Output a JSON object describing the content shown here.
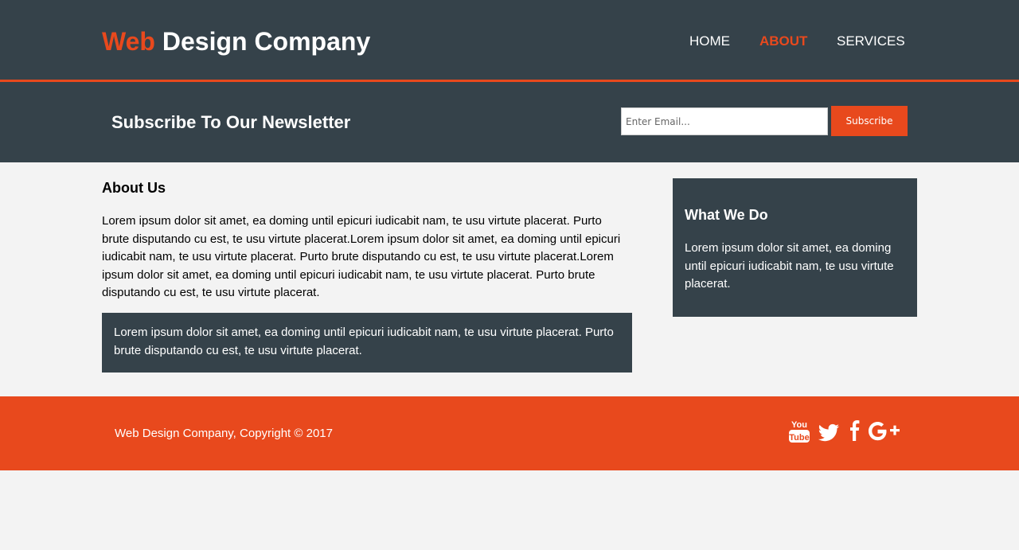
{
  "header": {
    "brand_accent": "Web",
    "brand_rest": " Design Company",
    "nav": [
      {
        "label": "HOME"
      },
      {
        "label": "ABOUT"
      },
      {
        "label": "SERVICES"
      }
    ],
    "active_nav": "ABOUT"
  },
  "newsletter": {
    "title": "Subscribe To Our Newsletter",
    "email_placeholder": "Enter Email...",
    "subscribe_label": "Subscribe"
  },
  "main": {
    "title": "About Us",
    "body": "Lorem ipsum dolor sit amet, ea doming until epicuri iudicabit nam, te usu virtute placerat. Purto brute disputando cu est, te usu virtute placerat.Lorem ipsum dolor sit amet, ea doming until epicuri iudicabit nam, te usu virtute placerat. Purto brute disputando cu est, te usu virtute placerat.Lorem ipsum dolor sit amet, ea doming until epicuri iudicabit nam, te usu virtute placerat. Purto brute disputando cu est, te usu virtute placerat.",
    "highlight": "Lorem ipsum dolor sit amet, ea doming until epicuri iudicabit nam, te usu virtute placerat. Purto brute disputando cu est, te usu virtute placerat."
  },
  "sidebar": {
    "title": "What We Do",
    "body": "Lorem ipsum dolor sit amet, ea doming until epicuri iudicabit nam, te usu virtute placerat."
  },
  "footer": {
    "copyright": "Web Design Company, Copyright © 2017",
    "social_icons": [
      "youtube-icon",
      "twitter-icon",
      "facebook-icon",
      "google-plus-icon"
    ]
  },
  "colors": {
    "dark": "#35424a",
    "accent": "#e8491d",
    "background": "#f3f3f3"
  }
}
